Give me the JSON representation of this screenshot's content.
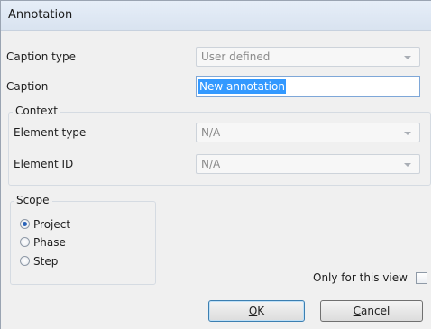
{
  "dialog": {
    "title": "Annotation"
  },
  "caption_type": {
    "label": "Caption type",
    "value": "User defined"
  },
  "caption": {
    "label": "Caption",
    "value": "New annotation"
  },
  "context": {
    "legend": "Context",
    "element_type": {
      "label": "Element type",
      "value": "N/A"
    },
    "element_id": {
      "label": "Element ID",
      "value": "N/A"
    }
  },
  "scope": {
    "legend": "Scope",
    "options": [
      {
        "label": "Project",
        "checked": true
      },
      {
        "label": "Phase",
        "checked": false
      },
      {
        "label": "Step",
        "checked": false
      }
    ]
  },
  "only_this_view": {
    "label": "Only for this view",
    "checked": false
  },
  "buttons": {
    "ok": {
      "mnemonic": "O",
      "rest": "K"
    },
    "cancel": {
      "mnemonic": "C",
      "rest": "ancel"
    }
  },
  "colors": {
    "accent": "#3399ff",
    "titlebar": "#dfe7f2",
    "background": "#f0f0f0"
  }
}
